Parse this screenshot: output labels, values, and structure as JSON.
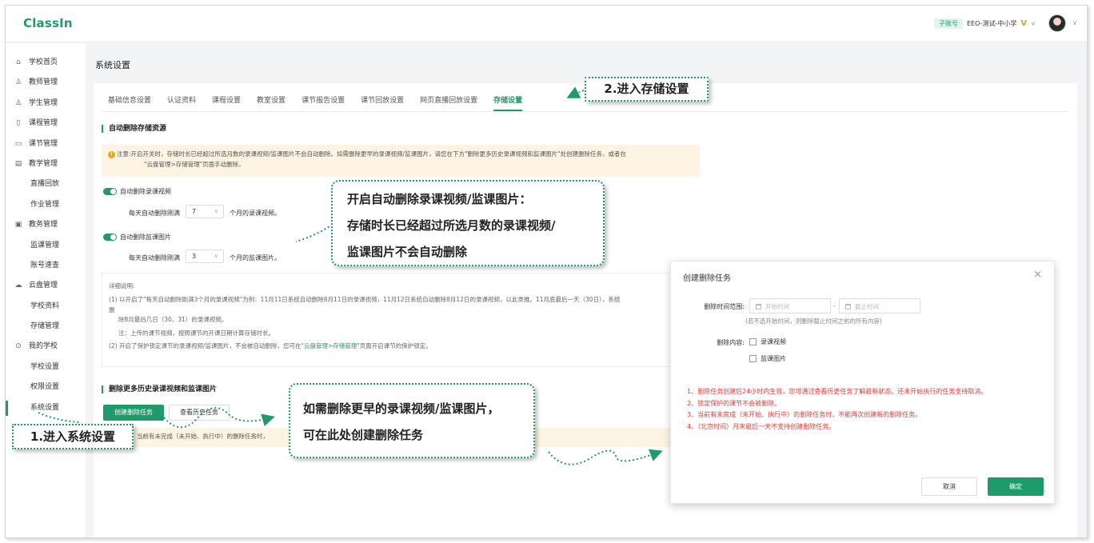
{
  "app": {
    "logo": "ClassIn"
  },
  "account": {
    "badge": "子账号",
    "name": "EEO-测试-中小学",
    "vip": "V"
  },
  "sidebar": {
    "items": [
      {
        "label": "学校首页",
        "icon": "home-icon",
        "glyph": "⌂"
      },
      {
        "label": "教师管理",
        "icon": "user-icon",
        "glyph": "♙"
      },
      {
        "label": "学生管理",
        "icon": "users-icon",
        "glyph": "♙"
      },
      {
        "label": "课程管理",
        "icon": "course-icon",
        "glyph": "▯"
      },
      {
        "label": "课节管理",
        "icon": "lesson-icon",
        "glyph": "▭"
      },
      {
        "label": "教学管理",
        "icon": "teaching-icon",
        "glyph": "▤"
      },
      {
        "label": "直播回放",
        "sub": true
      },
      {
        "label": "作业管理",
        "sub": true
      },
      {
        "label": "教务管理",
        "icon": "affairs-icon",
        "glyph": "▣"
      },
      {
        "label": "监课管理",
        "sub": true
      },
      {
        "label": "账号速查",
        "sub": true
      },
      {
        "label": "云盘管理",
        "icon": "cloud-icon",
        "glyph": "☁"
      },
      {
        "label": "学校资料",
        "sub": true
      },
      {
        "label": "存储管理",
        "sub": true
      },
      {
        "label": "我的学校",
        "icon": "school-icon",
        "glyph": "⊙"
      },
      {
        "label": "学校设置",
        "sub": true
      },
      {
        "label": "权限设置",
        "sub": true
      },
      {
        "label": "系统设置",
        "sub": true,
        "active": true
      }
    ]
  },
  "page": {
    "title": "系统设置"
  },
  "tabs": [
    "基础信息设置",
    "认证资料",
    "课程设置",
    "教室设置",
    "课节报告设置",
    "课节回放设置",
    "网页直播回放设置",
    "存储设置"
  ],
  "active_tab": 7,
  "auto_delete": {
    "title": "自动删除存储资源",
    "notice_prefix": "注意:",
    "notice_line1": "开启开关时，存储时长已经超过所选月数的录课视频/监课图片不会自动删除。如需删除更早的录课视频/监课图片，请您在下方\"删除更多历史录课视频和监课图片\"处创建删除任务，或者在",
    "notice_line2": "\"云盘管理>存储管理\"页面手动删除。",
    "video_toggle": "自动删除录课视频",
    "video_prefix": "每天自动删除刚满",
    "video_value": "7",
    "video_suffix": "个月的录课视频。",
    "image_toggle": "自动删除监课图片",
    "image_prefix": "每天自动删除刚满",
    "image_value": "3",
    "image_suffix": "个月的监课图片。"
  },
  "detail": {
    "title": "详细说明:",
    "line1": "(1) 以开启了\"每天自动删除刚满3个月的录课视频\"为例：11月11日系统自动删除8月11日的录课视频，11月12日系统自动删除8月12日的录课视频，以此类推。11月底最后一天（30日），系统",
    "line1b": "删",
    "line2": "除8月最后几日（30、31）的录课视频。",
    "line3": "注：上传的课节视频，按照课节的开课日期计算存储时长。",
    "line4_a": "(2) 开启了保护锁定课节的录课视频/监课图片，不会被自动删除，您可在",
    "line4_link": "\"云盘管理>存储管理\"",
    "line4_b": "页面开启课节的保护锁定。"
  },
  "history": {
    "title": "删除更多历史录课视频和监课图片",
    "create_button": "创建删除任务",
    "view_button": "查看历史任务",
    "notice": "当前有未完成（未开始、执行中）的删除任务时，"
  },
  "modal": {
    "title": "创建删除任务",
    "range_label": "删除时间范围:",
    "start_placeholder": "开始时间",
    "end_placeholder": "截止时间",
    "range_sep": "-",
    "range_hint": "(若不选开始时间，则删除截止时间之前的所有内容)",
    "content_label": "删除内容:",
    "opt_video": "录课视频",
    "opt_image": "监课图片",
    "notes": [
      "1、删除任务创建后24小时内生效，您可通过查看历史任务了解最新状态。还未开始执行的任务支持取消。",
      "2、锁定保护的课节不会被删除。",
      "3、当前有未完成（未开始、执行中）的删除任务时，不能再次创建新的删除任务。",
      "4、（北京时间）月末最后一天不支持创建删除任务。"
    ],
    "cancel": "取消",
    "confirm": "确定"
  },
  "callouts": {
    "step1": "1.进入系统设置",
    "step2": "2.进入存储设置",
    "auto_l1": "开启自动删除录课视频/监课图片：",
    "auto_l2": "存储时长已经超过所选月数的录课视频/",
    "auto_l3": "监课图片不会自动删除",
    "create_l1": "如需删除更早的录课视频/监课图片，",
    "create_l2": "可在此处创建删除任务"
  },
  "colors": {
    "brand": "#1f9a6a",
    "warn_bg": "#fdf4e3",
    "alert_red": "#e53935"
  }
}
